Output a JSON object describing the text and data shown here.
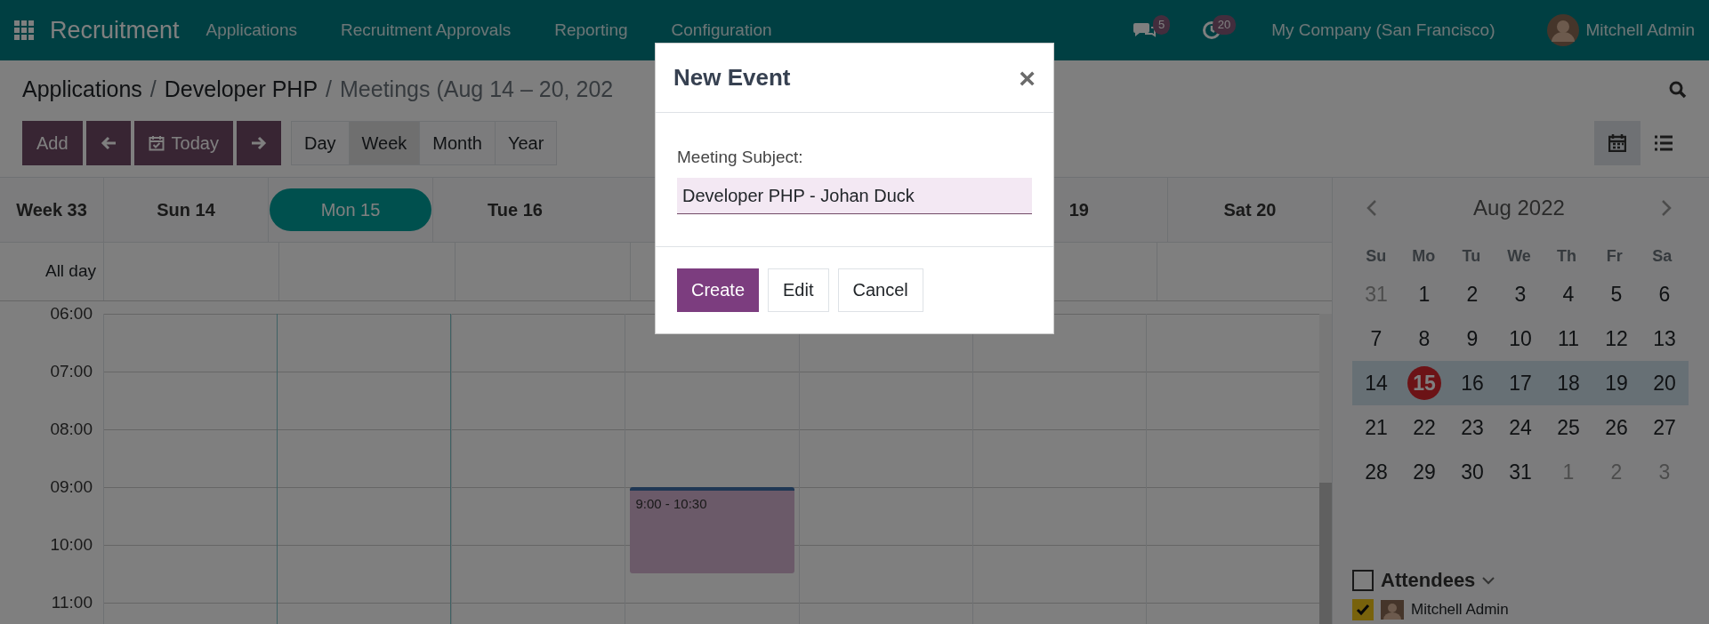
{
  "topbar": {
    "app": "Recruitment",
    "menu": [
      "Applications",
      "Recruitment Approvals",
      "Reporting",
      "Configuration"
    ],
    "messages_badge": "5",
    "activities_badge": "20",
    "company": "My Company (San Francisco)",
    "user": "Mitchell Admin"
  },
  "breadcrumb": [
    {
      "label": "Applications",
      "kind": "link"
    },
    {
      "label": "/",
      "kind": "sep"
    },
    {
      "label": "Developer PHP",
      "kind": "link"
    },
    {
      "label": "/",
      "kind": "sep"
    },
    {
      "label": "Meetings (Aug 14 – 20, 202",
      "kind": "current"
    }
  ],
  "toolbar": {
    "add": "Add",
    "today": "Today",
    "scales": [
      {
        "label": "Day",
        "selected": false
      },
      {
        "label": "Week",
        "selected": true
      },
      {
        "label": "Month",
        "selected": false
      },
      {
        "label": "Year",
        "selected": false
      }
    ],
    "views": [
      {
        "kind": "calendar",
        "selected": true
      },
      {
        "kind": "list",
        "selected": false
      }
    ]
  },
  "calendar": {
    "week": "Week 33",
    "all_day": "All day",
    "days": [
      {
        "label": "Sun 14",
        "selected": false,
        "kind": "full"
      },
      {
        "label": "Mon 15",
        "selected": true,
        "kind": "full"
      },
      {
        "label": "Tue 16",
        "selected": false,
        "kind": "full"
      },
      {
        "selected": false,
        "kind": "hidden",
        "events": [
          {
            "label": "9:00 - 10:30"
          }
        ]
      },
      {
        "selected": false,
        "kind": "hidden"
      },
      {
        "label": "19",
        "selected": false,
        "kind": "cut"
      },
      {
        "label": "Sat 20",
        "selected": false,
        "kind": "full"
      }
    ],
    "hours": [
      "06:00",
      "07:00",
      "08:00",
      "09:00",
      "10:00",
      "11:00"
    ]
  },
  "mini_calendar": {
    "title": "Aug 2022",
    "weekdays": [
      "Su",
      "Mo",
      "Tu",
      "We",
      "Th",
      "Fr",
      "Sa"
    ],
    "weeks": [
      {
        "selected": false,
        "days": [
          {
            "label": "31",
            "kind": "out"
          },
          {
            "label": "1",
            "kind": "in"
          },
          {
            "label": "2",
            "kind": "in"
          },
          {
            "label": "3",
            "kind": "in"
          },
          {
            "label": "4",
            "kind": "in"
          },
          {
            "label": "5",
            "kind": "in"
          },
          {
            "label": "6",
            "kind": "in"
          }
        ]
      },
      {
        "selected": false,
        "days": [
          {
            "label": "7",
            "kind": "in"
          },
          {
            "label": "8",
            "kind": "in"
          },
          {
            "label": "9",
            "kind": "in"
          },
          {
            "label": "10",
            "kind": "in"
          },
          {
            "label": "11",
            "kind": "in"
          },
          {
            "label": "12",
            "kind": "in"
          },
          {
            "label": "13",
            "kind": "in"
          }
        ]
      },
      {
        "selected": true,
        "days": [
          {
            "label": "14",
            "kind": "in"
          },
          {
            "label": "15",
            "kind": "today"
          },
          {
            "label": "16",
            "kind": "in"
          },
          {
            "label": "17",
            "kind": "in"
          },
          {
            "label": "18",
            "kind": "in"
          },
          {
            "label": "19",
            "kind": "in"
          },
          {
            "label": "20",
            "kind": "in"
          }
        ]
      },
      {
        "selected": false,
        "days": [
          {
            "label": "21",
            "kind": "in"
          },
          {
            "label": "22",
            "kind": "in"
          },
          {
            "label": "23",
            "kind": "in"
          },
          {
            "label": "24",
            "kind": "in"
          },
          {
            "label": "25",
            "kind": "in"
          },
          {
            "label": "26",
            "kind": "in"
          },
          {
            "label": "27",
            "kind": "in"
          }
        ]
      },
      {
        "selected": false,
        "days": [
          {
            "label": "28",
            "kind": "in"
          },
          {
            "label": "29",
            "kind": "in"
          },
          {
            "label": "30",
            "kind": "in"
          },
          {
            "label": "31",
            "kind": "in"
          },
          {
            "label": "1",
            "kind": "out"
          },
          {
            "label": "2",
            "kind": "out"
          },
          {
            "label": "3",
            "kind": "out"
          }
        ]
      }
    ]
  },
  "attendees": {
    "label": "Attendees",
    "checked": false,
    "items": [
      {
        "name": "Mitchell Admin",
        "checked": true
      }
    ]
  },
  "dialog": {
    "title": "New Event",
    "close": "×",
    "field_label": "Meeting Subject:",
    "value": "Developer PHP - Johan Duck",
    "buttons": [
      {
        "label": "Create",
        "kind": "primary"
      },
      {
        "label": "Edit",
        "kind": "secondary"
      },
      {
        "label": "Cancel",
        "kind": "secondary"
      }
    ]
  }
}
